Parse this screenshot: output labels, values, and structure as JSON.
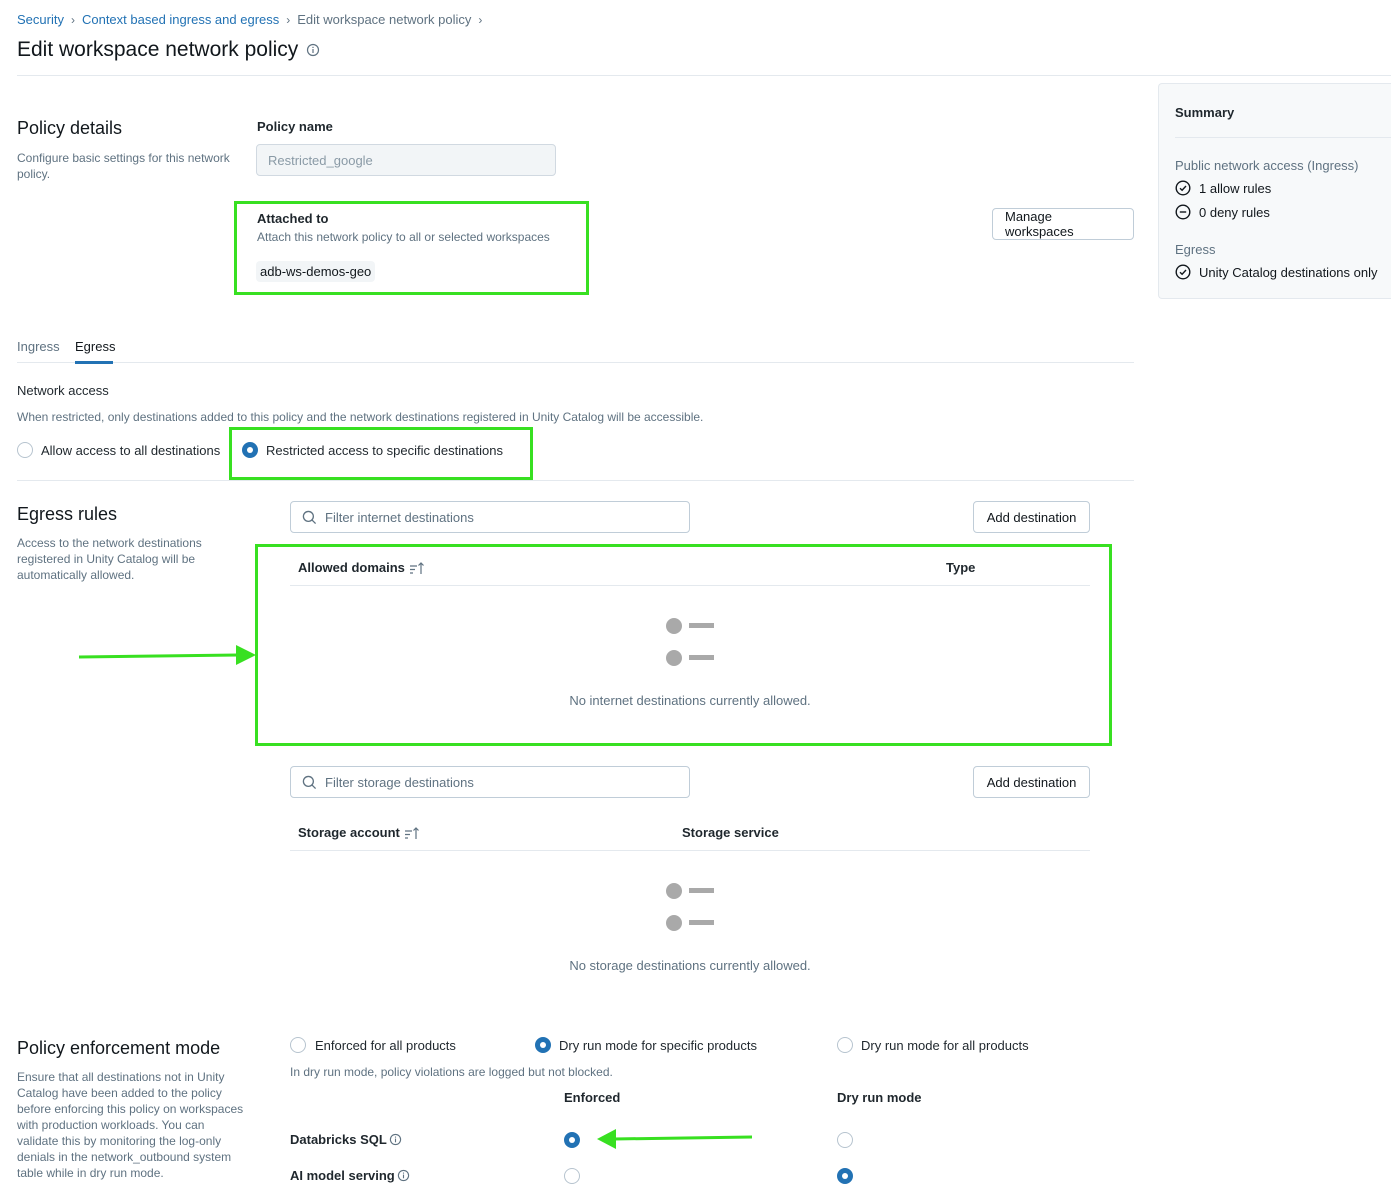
{
  "breadcrumb": {
    "items": [
      "Security",
      "Context based ingress and egress",
      "Edit workspace network policy"
    ]
  },
  "page_title": "Edit workspace network policy",
  "policy_details": {
    "title": "Policy details",
    "description": "Configure basic settings for this network policy.",
    "policy_name_label": "Policy name",
    "policy_name_value": "Restricted_google",
    "attached_to_label": "Attached to",
    "attached_to_description": "Attach this network policy to all or selected workspaces",
    "workspace_chip": "adb-ws-demos-geo",
    "manage_workspaces_button": "Manage workspaces"
  },
  "summary": {
    "title": "Summary",
    "ingress_title": "Public network access (Ingress)",
    "allow_rules": "1 allow rules",
    "deny_rules": "0 deny rules",
    "egress_title": "Egress",
    "egress_value": "Unity Catalog destinations only"
  },
  "tabs": [
    {
      "label": "Ingress",
      "active": false
    },
    {
      "label": "Egress",
      "active": true
    }
  ],
  "network_access": {
    "label": "Network access",
    "description": "When restricted, only destinations added to this policy and the network destinations registered in Unity Catalog will be accessible.",
    "option_all": "Allow access to all destinations",
    "option_restricted": "Restricted access to specific destinations",
    "selected": "restricted"
  },
  "egress_rules": {
    "title": "Egress rules",
    "description": "Access to the network destinations registered in Unity Catalog will be automatically allowed.",
    "internet": {
      "filter_placeholder": "Filter internet destinations",
      "add_button": "Add destination",
      "col_domains": "Allowed domains",
      "col_type": "Type",
      "empty_text": "No internet destinations currently allowed."
    },
    "storage": {
      "filter_placeholder": "Filter storage destinations",
      "add_button": "Add destination",
      "col_account": "Storage account",
      "col_service": "Storage service",
      "empty_text": "No storage destinations currently allowed."
    }
  },
  "enforcement": {
    "title": "Policy enforcement mode",
    "description": "Ensure that all destinations not in Unity Catalog have been added to the policy before enforcing this policy on workspaces with production workloads. You can validate this by monitoring the log-only denials in the network_outbound system table while in dry run mode.",
    "option_enforced_all": "Enforced for all products",
    "option_dry_specific": "Dry run mode for specific products",
    "option_dry_all": "Dry run mode for all products",
    "selected": "dry_specific",
    "note": "In dry run mode, policy violations are logged but not blocked.",
    "col_enforced": "Enforced",
    "col_dry_run": "Dry run mode",
    "products": [
      {
        "name": "Databricks SQL",
        "mode": "enforced"
      },
      {
        "name": "AI model serving",
        "mode": "dry_run"
      }
    ]
  },
  "colors": {
    "accent": "#2272b4",
    "highlight": "#38e021",
    "muted_text": "#5f7281"
  }
}
